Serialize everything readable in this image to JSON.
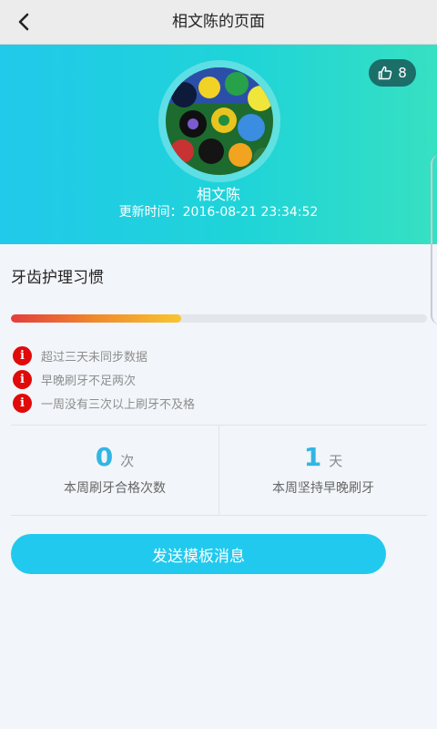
{
  "header": {
    "title": "相文陈的页面"
  },
  "profile": {
    "name": "相文陈",
    "update_time": "更新时间：2016-08-21 23:34:52",
    "like_count": "8"
  },
  "habit": {
    "title": "牙齿护理习惯",
    "progress": 0.41,
    "warnings": [
      {
        "text": "超过三天未同步数据",
        "icon": "warning-icon"
      },
      {
        "text": "早晚刷牙不足两次",
        "icon": "warning-icon"
      },
      {
        "text": "一周没有三次以上刷牙不及格",
        "icon": "warning-icon"
      }
    ]
  },
  "stats": [
    {
      "value": "0",
      "unit": "次",
      "label": "本周刷牙合格次数"
    },
    {
      "value": "1",
      "unit": "天",
      "label": "本周坚持早晚刷牙"
    }
  ],
  "actions": {
    "send_label": "发送模板消息"
  },
  "colors": {
    "hero_start": "#21c9ea",
    "hero_end": "#36e0c2",
    "accent": "#22c9ee",
    "warning": "#e10a0a",
    "stat_value": "#31b6e3"
  }
}
